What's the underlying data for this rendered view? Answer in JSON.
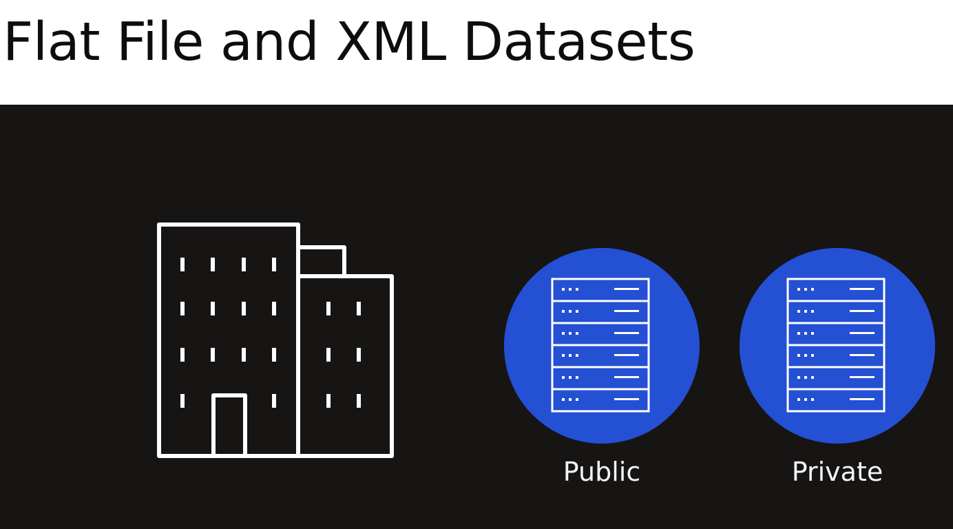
{
  "slide": {
    "title": "Flat File and XML Datasets"
  },
  "icons": {
    "building": "office-building-icon",
    "server": "server-rack-icon"
  },
  "colors": {
    "stage_background": "#171414",
    "circle_fill": "#2450d4",
    "line_color": "#ffffff"
  },
  "datasets": [
    {
      "label": "Public"
    },
    {
      "label": "Private"
    }
  ]
}
